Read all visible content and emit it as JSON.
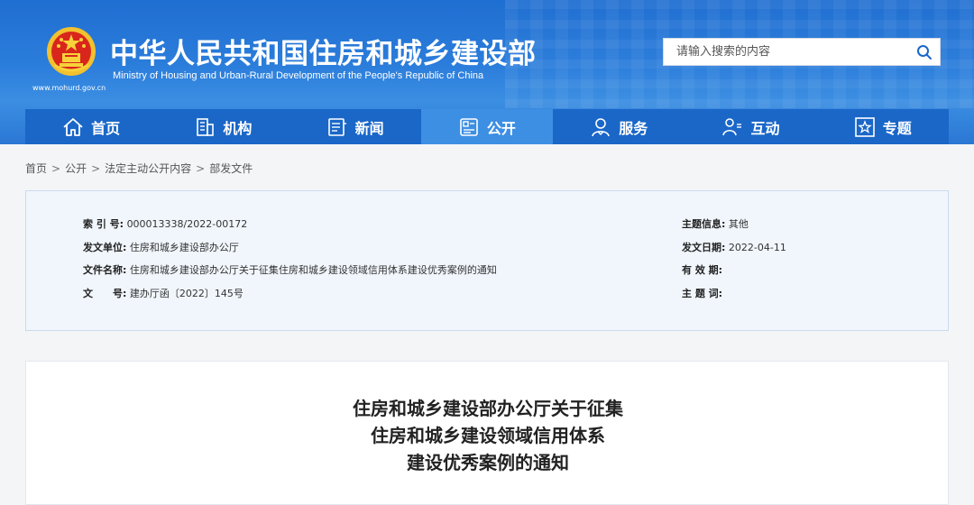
{
  "header": {
    "title_cn": "中华人民共和国住房和城乡建设部",
    "title_en": "Ministry of Housing and Urban-Rural Development of the People's Republic of China",
    "site_url": "www.mohurd.gov.cn",
    "logo_icon": "national-emblem-icon",
    "colors": {
      "primary": "#1a67c8",
      "nav_active": "#3d8fe3",
      "header_bg": "#2b7ddb"
    }
  },
  "search": {
    "placeholder": "请输入搜索的内容",
    "icon": "search-icon"
  },
  "nav": {
    "items": [
      {
        "label": "首页",
        "icon": "home-icon"
      },
      {
        "label": "机构",
        "icon": "building-icon"
      },
      {
        "label": "新闻",
        "icon": "news-icon"
      },
      {
        "label": "公开",
        "icon": "disclosure-icon",
        "active": true
      },
      {
        "label": "服务",
        "icon": "service-icon"
      },
      {
        "label": "互动",
        "icon": "interaction-icon"
      },
      {
        "label": "专题",
        "icon": "star-icon"
      }
    ]
  },
  "breadcrumb": {
    "items": [
      "首页",
      "公开",
      "法定主动公开内容",
      "部发文件"
    ],
    "separator": ">"
  },
  "info": {
    "index_label": "索 引 号:",
    "index_value": "000013338/2022-00172",
    "issuer_label": "发文单位:",
    "issuer_value": "住房和城乡建设部办公厅",
    "docname_label": "文件名称:",
    "docname_value": "住房和城乡建设部办公厅关于征集住房和城乡建设领域信用体系建设优秀案例的通知",
    "docno_label": "文　　号:",
    "docno_value": "建办厅函〔2022〕145号",
    "topic_label": "主题信息:",
    "topic_value": "其他",
    "date_label": "发文日期:",
    "date_value": "2022-04-11",
    "validity_label": "有 效 期:",
    "validity_value": "",
    "keywords_label": "主 题 词:",
    "keywords_value": ""
  },
  "document": {
    "title_lines": [
      "住房和城乡建设部办公厅关于征集",
      "住房和城乡建设领域信用体系",
      "建设优秀案例的通知"
    ]
  }
}
